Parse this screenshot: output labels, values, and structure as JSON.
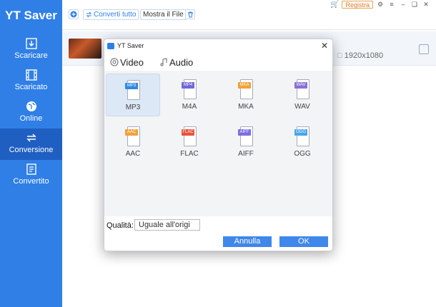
{
  "app": {
    "title": "YT Saver"
  },
  "sidebar": {
    "items": [
      {
        "label": "Scaricare",
        "icon": "download-icon"
      },
      {
        "label": "Scaricato",
        "icon": "film-icon"
      },
      {
        "label": "Online",
        "icon": "globe-icon"
      },
      {
        "label": "Conversione",
        "icon": "convert-icon",
        "active": true
      },
      {
        "label": "Convertito",
        "icon": "document-icon"
      }
    ]
  },
  "toolbar": {
    "convert_all_label": "Converti tutto",
    "show_file_label": "Mostra il File",
    "register_label": "Registra"
  },
  "video": {
    "resolution": "1920x1080"
  },
  "dialog": {
    "title": "YT Saver",
    "tabs": [
      {
        "label": "Video",
        "icon": "video-icon"
      },
      {
        "label": "Audio",
        "icon": "music-note-icon",
        "active": true
      }
    ],
    "formats": [
      {
        "tag": "MP3",
        "label": "MP3",
        "color": "#2f8ae0",
        "selected": true
      },
      {
        "tag": "MP4",
        "label": "M4A",
        "color": "#6f6ad6"
      },
      {
        "tag": "MKA",
        "label": "MKA",
        "color": "#f0a23a"
      },
      {
        "tag": "WAV",
        "label": "WAV",
        "color": "#8a6fd6"
      },
      {
        "tag": "AAC",
        "label": "AAC",
        "color": "#f0a23a"
      },
      {
        "tag": "FLAC",
        "label": "FLAC",
        "color": "#e8533c"
      },
      {
        "tag": "AIFF",
        "label": "AIFF",
        "color": "#7a6fe0"
      },
      {
        "tag": "OGG",
        "label": "OGG",
        "color": "#4aa4ea"
      }
    ],
    "quality_label": "Qualità:",
    "quality_value": "Uguale all'origi",
    "cancel_label": "Annulla",
    "ok_label": "OK"
  },
  "colors": {
    "accent": "#2f7fe6",
    "sidebar_active": "#1f5fc2",
    "button": "#3f87ea"
  }
}
